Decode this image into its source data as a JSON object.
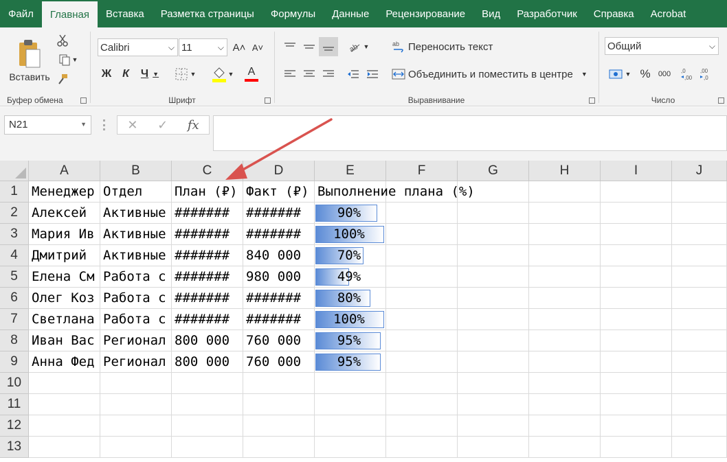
{
  "menu": {
    "tabs": [
      "Файл",
      "Главная",
      "Вставка",
      "Разметка страницы",
      "Формулы",
      "Данные",
      "Рецензирование",
      "Вид",
      "Разработчик",
      "Справка",
      "Acrobat"
    ],
    "active_index": 1
  },
  "ribbon": {
    "clipboard": {
      "paste_label": "Вставить",
      "group_label": "Буфер обмена"
    },
    "font": {
      "font_name": "Calibri",
      "font_size": "11",
      "bold": "Ж",
      "italic": "К",
      "underline": "Ч",
      "grow": "A˄",
      "shrink": "A˅",
      "font_color_glyph": "A",
      "group_label": "Шрифт"
    },
    "alignment": {
      "wrap_label": "Переносить текст",
      "merge_label": "Объединить и поместить в центре",
      "group_label": "Выравнивание"
    },
    "number": {
      "format": "Общий",
      "percent": "%",
      "thousands": "000",
      "group_label": "Число"
    }
  },
  "formula_bar": {
    "name_box": "N21",
    "fx": "fx",
    "cancel": "✕",
    "enter": "✓",
    "formula": ""
  },
  "sheet": {
    "columns": [
      "A",
      "B",
      "C",
      "D",
      "E",
      "F",
      "G",
      "H",
      "I",
      "J"
    ],
    "rows": [
      "1",
      "2",
      "3",
      "4",
      "5",
      "6",
      "7",
      "8",
      "9",
      "10",
      "11",
      "12",
      "13"
    ],
    "header_row": [
      "Менеджер",
      "Отдел",
      "План (₽)",
      "Факт (₽)",
      "Выполнение плана (%)"
    ],
    "data_rows": [
      {
        "a": "Алексей",
        "b": "Активные",
        "c": "#######",
        "d": "#######",
        "e": "90%",
        "e_value": 0.9
      },
      {
        "a": "Мария Ив",
        "b": "Активные",
        "c": "#######",
        "d": "#######",
        "e": "100%",
        "e_value": 1.0
      },
      {
        "a": "Дмитрий",
        "b": "Активные",
        "c": "#######",
        "d": "840 000",
        "e": "70%",
        "e_value": 0.7
      },
      {
        "a": "Елена См",
        "b": "Работа с",
        "c": "#######",
        "d": "980 000",
        "e": "49%",
        "e_value": 0.49
      },
      {
        "a": "Олег Коз",
        "b": "Работа с",
        "c": "#######",
        "d": "#######",
        "e": "80%",
        "e_value": 0.8
      },
      {
        "a": "Светлана",
        "b": "Работа с",
        "c": "#######",
        "d": "#######",
        "e": "100%",
        "e_value": 1.0
      },
      {
        "a": "Иван Вас",
        "b": "Регионал",
        "c": "800 000",
        "d": "760 000",
        "e": "95%",
        "e_value": 0.95
      },
      {
        "a": "Анна Фед",
        "b": "Регионал",
        "c": "800 000",
        "d": "760 000",
        "e": "95%",
        "e_value": 0.95
      }
    ],
    "databar_color": "#5b8bd6"
  },
  "annotation": {
    "arrow_color": "#d9534f"
  }
}
